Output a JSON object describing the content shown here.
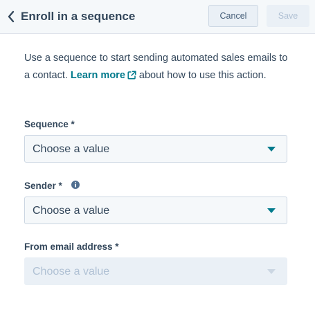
{
  "header": {
    "title": "Enroll in a sequence",
    "cancel_label": "Cancel",
    "save_label": "Save"
  },
  "description": {
    "before_link": "Use a sequence to start sending automated sales emails to a contact.",
    "link_text": "Learn more",
    "after_link": "about how to use this action."
  },
  "fields": {
    "sequence": {
      "label": "Sequence *",
      "value": "Choose a value"
    },
    "sender": {
      "label": "Sender *",
      "value": "Choose a value"
    },
    "from_email": {
      "label": "From email address *",
      "value": "Choose a value"
    }
  },
  "icons": {
    "back": "chevron-left-icon",
    "external_link": "external-link-icon",
    "info": "info-icon",
    "caret": "caret-down-icon"
  },
  "colors": {
    "link": "#007a8c",
    "text": "#33475b",
    "caret": "#007a8c",
    "disabled_text": "#b0c1d4"
  }
}
